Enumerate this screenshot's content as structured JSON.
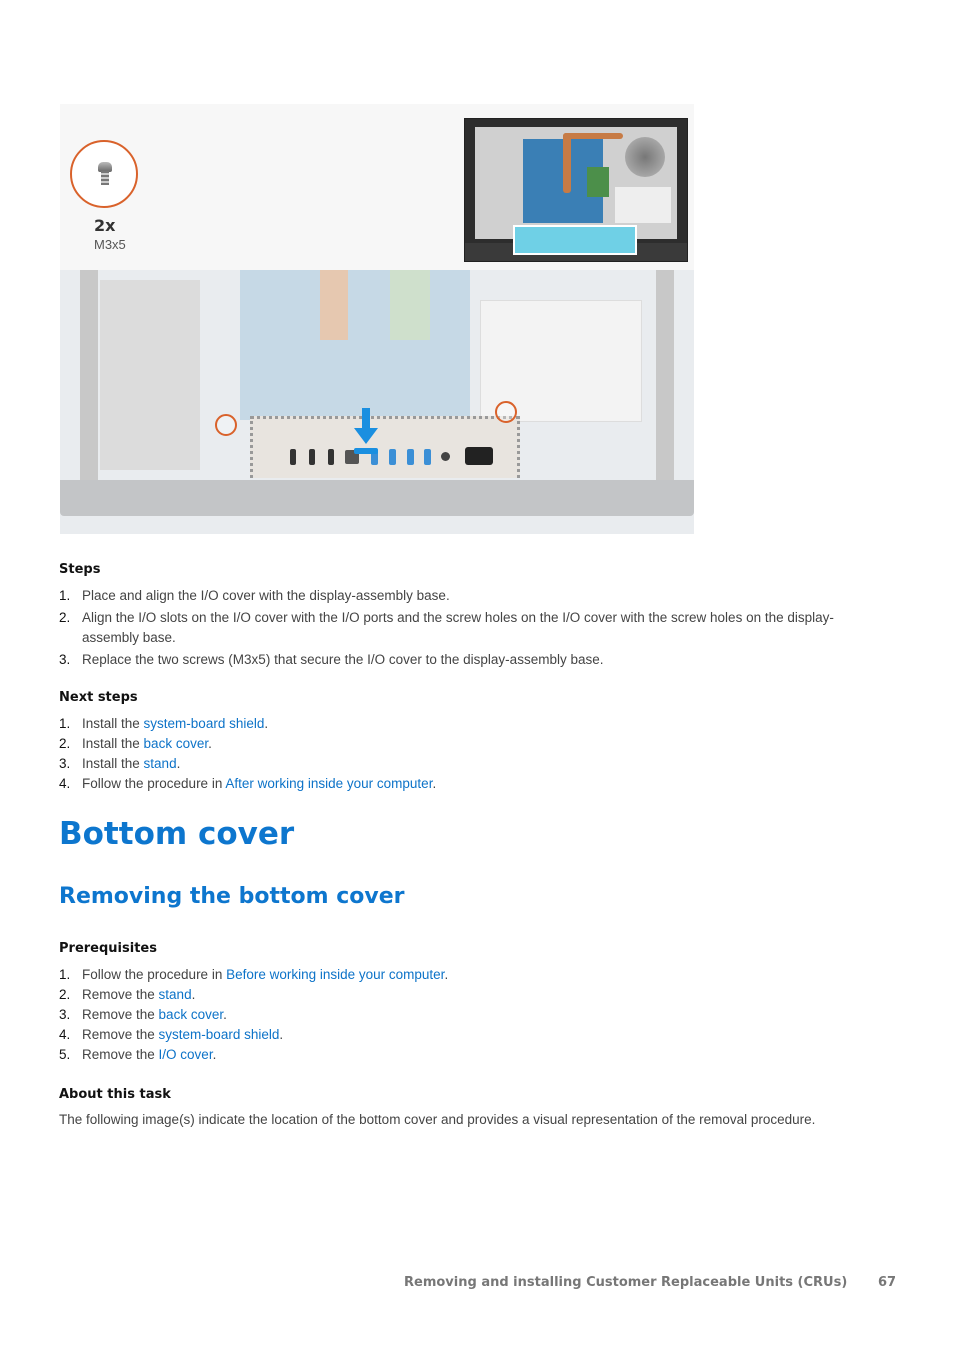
{
  "figure": {
    "screw_quantity": "2x",
    "screw_size": "M3x5"
  },
  "steps": {
    "heading": "Steps",
    "items": [
      {
        "num": "1.",
        "text": "Place and align the I/O cover with the display-assembly base."
      },
      {
        "num": "2.",
        "text": "Align the I/O slots on the I/O cover with the I/O ports and the screw holes on the I/O cover with the screw holes on the display-assembly base."
      },
      {
        "num": "3.",
        "text": "Replace the two screws (M3x5) that secure the I/O cover to the display-assembly base."
      }
    ]
  },
  "next_steps": {
    "heading": "Next steps",
    "items": [
      {
        "num": "1.",
        "prefix": "Install the ",
        "link": "system-board shield",
        "suffix": "."
      },
      {
        "num": "2.",
        "prefix": "Install the ",
        "link": "back cover",
        "suffix": "."
      },
      {
        "num": "3.",
        "prefix": "Install the ",
        "link": "stand",
        "suffix": "."
      },
      {
        "num": "4.",
        "prefix": "Follow the procedure in ",
        "link": "After working inside your computer",
        "suffix": "."
      }
    ]
  },
  "section": {
    "title": "Bottom cover",
    "subtitle": "Removing the bottom cover"
  },
  "prerequisites": {
    "heading": "Prerequisites",
    "items": [
      {
        "num": "1.",
        "prefix": "Follow the procedure in ",
        "link": "Before working inside your computer",
        "suffix": "."
      },
      {
        "num": "2.",
        "prefix": "Remove the ",
        "link": "stand",
        "suffix": "."
      },
      {
        "num": "3.",
        "prefix": "Remove the ",
        "link": "back cover",
        "suffix": "."
      },
      {
        "num": "4.",
        "prefix": "Remove the ",
        "link": "system-board shield",
        "suffix": "."
      },
      {
        "num": "5.",
        "prefix": "Remove the ",
        "link": "I/O cover",
        "suffix": "."
      }
    ]
  },
  "about": {
    "heading": "About this task",
    "text": "The following image(s) indicate the location of the bottom cover and provides a visual representation of the removal procedure."
  },
  "footer": {
    "title": "Removing and installing Customer Replaceable Units (CRUs)",
    "page": "67"
  },
  "colors": {
    "heading_blue": "#0d76ce",
    "link_blue": "#0d73c8",
    "callout_orange": "#d9622b",
    "arrow_blue": "#1a8fe0"
  }
}
